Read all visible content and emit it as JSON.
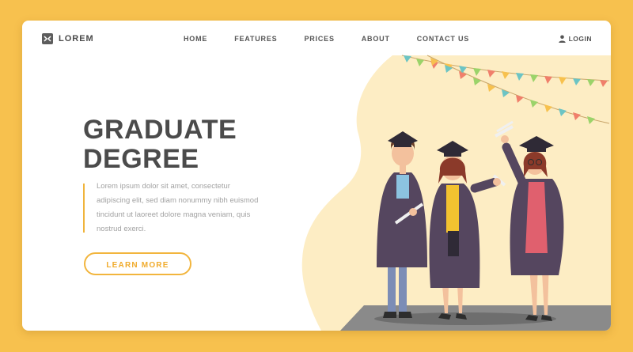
{
  "brand": {
    "name": "LOREM"
  },
  "nav": {
    "items": [
      {
        "label": "HOME"
      },
      {
        "label": "FEATURES"
      },
      {
        "label": "PRICES"
      },
      {
        "label": "ABOUT"
      },
      {
        "label": "CONTACT US"
      }
    ],
    "login_label": "LOGIN"
  },
  "hero": {
    "title_line1": "GRADUATE",
    "title_line2": "DEGREE",
    "description": "Lorem ipsum dolor sit amet, consectetur adipiscing elit, sed diam nonummy nibh euismod tincidunt ut laoreet dolore magna veniam, quis nostrud exerci.",
    "button_label": "LEARN MORE"
  },
  "colors": {
    "page_background": "#f7c14e",
    "accent": "#f2b53d",
    "blob": "#fdedc4",
    "gown": "#55465f"
  },
  "icons": [
    "logo-icon",
    "user-icon"
  ]
}
